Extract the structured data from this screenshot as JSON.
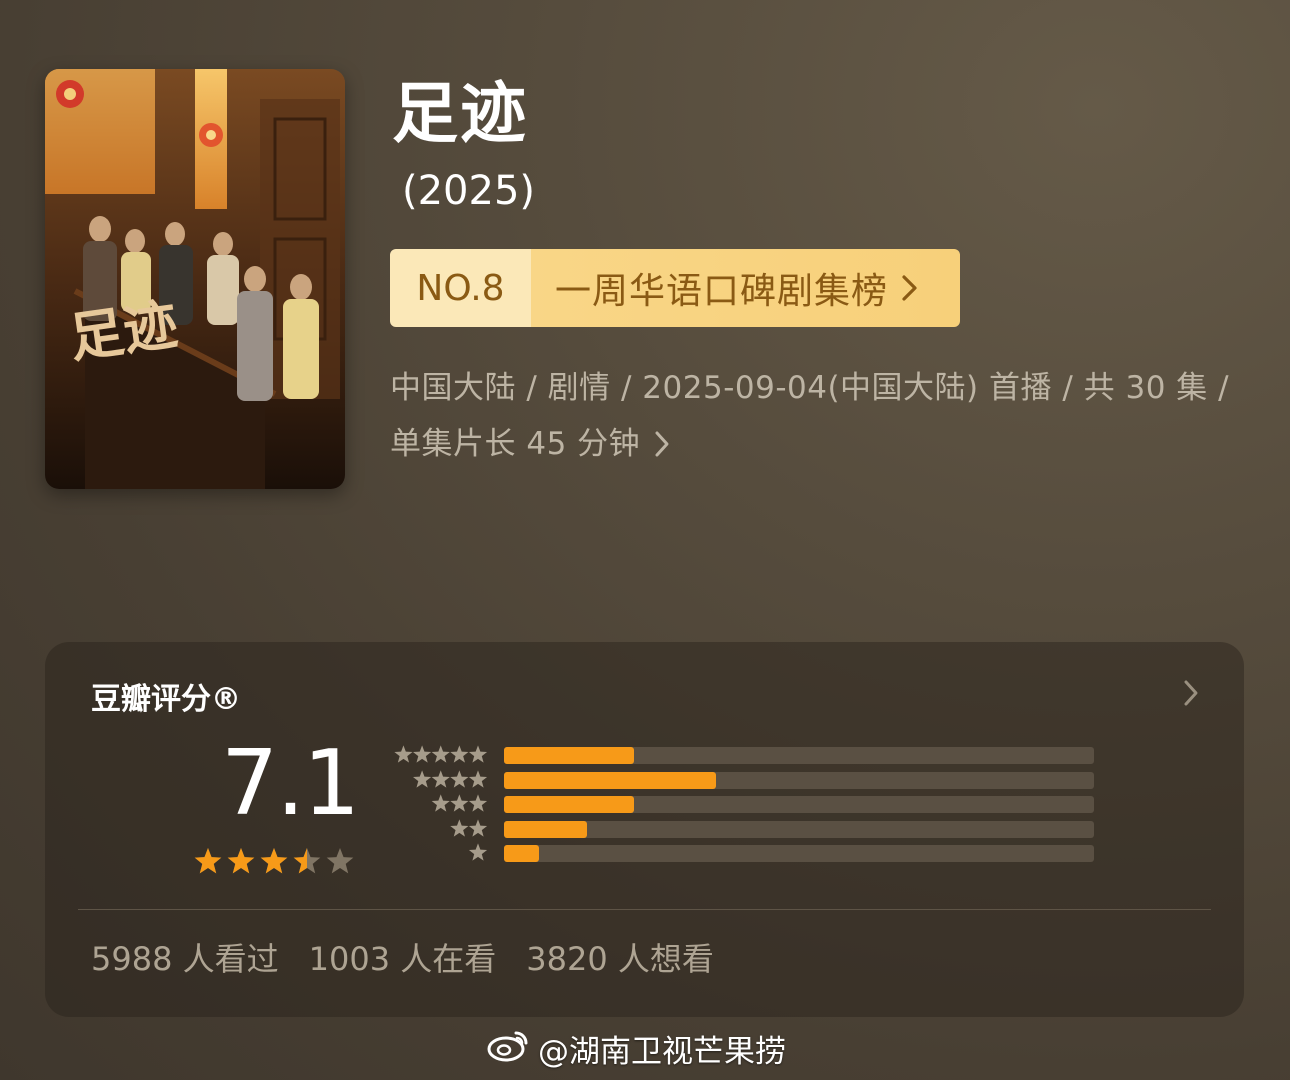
{
  "show": {
    "title": "足迹",
    "year": "(2025)",
    "poster_text": "足迹"
  },
  "ranking": {
    "number": "NO.8",
    "name": "一周华语口碑剧集榜"
  },
  "meta": {
    "line1": "中国大陆 / 剧情 / 2025-09-04(中国大陆) 首播 / 共 30 集 /",
    "line2": "单集片长 45 分钟"
  },
  "rating": {
    "label": "豆瓣评分®",
    "score": "7.1",
    "stars": 3.5,
    "distribution": [
      {
        "stars": 5,
        "fraction": 0.22
      },
      {
        "stars": 4,
        "fraction": 0.36
      },
      {
        "stars": 3,
        "fraction": 0.22
      },
      {
        "stars": 2,
        "fraction": 0.14
      },
      {
        "stars": 1,
        "fraction": 0.06
      }
    ]
  },
  "stats": {
    "watched": "5988 人看过",
    "watching": "1003 人在看",
    "want": "3820 人想看"
  },
  "watermark": {
    "text": "@湖南卫视芒果捞"
  },
  "colors": {
    "accent": "#f79a18",
    "badge_text": "#8a5a14",
    "badge_bg": "#f9d687"
  }
}
